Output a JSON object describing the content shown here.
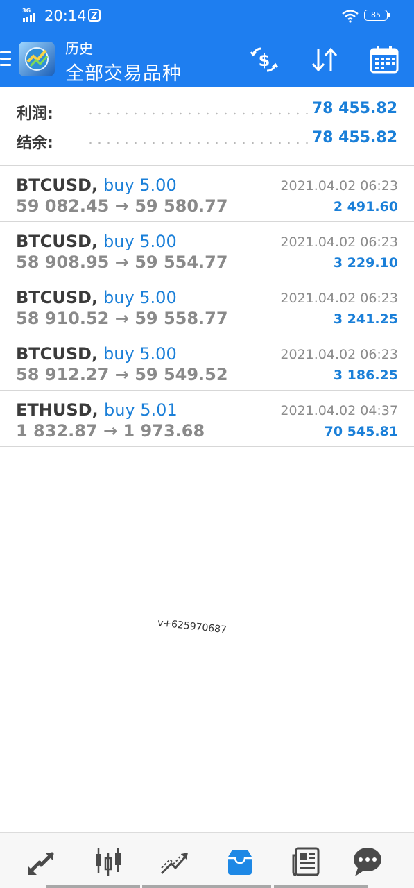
{
  "status_bar": {
    "network": "3G",
    "time": "20:14",
    "battery": "85"
  },
  "header": {
    "subtitle": "历史",
    "title": "全部交易品种",
    "icons": [
      "menu-icon",
      "app-logo",
      "currency-icon",
      "sort-icon",
      "calendar-icon"
    ]
  },
  "summary": {
    "profit_label": "利润:",
    "profit_value": "78 455.82",
    "balance_label": "结余:",
    "balance_value": "78 455.82"
  },
  "deals": [
    {
      "symbol": "BTCUSD,",
      "side": "buy 5.00",
      "prices": "59 082.45 → 59 580.77",
      "time": "2021.04.02 06:23",
      "profit": "2 491.60"
    },
    {
      "symbol": "BTCUSD,",
      "side": "buy 5.00",
      "prices": "58 908.95 → 59 554.77",
      "time": "2021.04.02 06:23",
      "profit": "3 229.10"
    },
    {
      "symbol": "BTCUSD,",
      "side": "buy 5.00",
      "prices": "58 910.52 → 59 558.77",
      "time": "2021.04.02 06:23",
      "profit": "3 241.25"
    },
    {
      "symbol": "BTCUSD,",
      "side": "buy 5.00",
      "prices": "58 912.27 → 59 549.52",
      "time": "2021.04.02 06:23",
      "profit": "3 186.25"
    },
    {
      "symbol": "ETHUSD,",
      "side": "buy 5.01",
      "prices": "1 832.87 → 1 973.68",
      "time": "2021.04.02 04:37",
      "profit": "70 545.81"
    }
  ],
  "watermark": "v+625970687",
  "bottom_nav": {
    "items": [
      "trade-icon",
      "chart-icon",
      "analytics-icon",
      "history-icon",
      "news-icon",
      "chat-icon"
    ],
    "active": "history-icon"
  },
  "colors": {
    "header": "#1e7ef0",
    "accent": "#1a7fd8",
    "text_dark": "#3b3b3b",
    "text_gray": "#8a8a8a",
    "nav_icon": "#4a4a4a",
    "nav_active": "#1e88e5"
  }
}
